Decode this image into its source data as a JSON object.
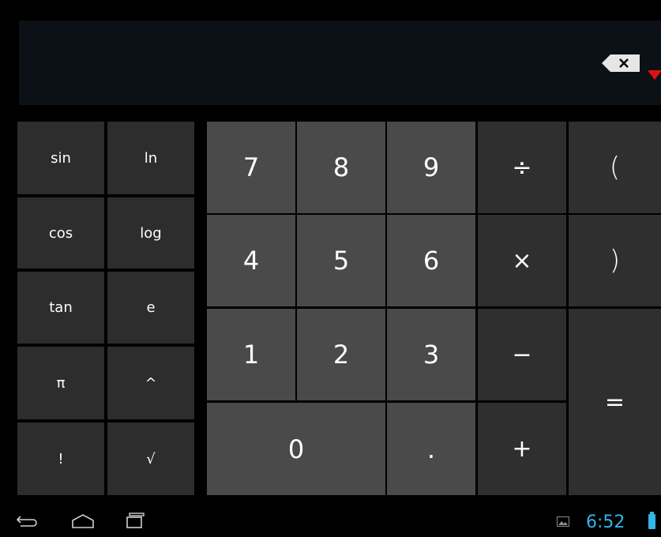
{
  "advanced_keys": [
    {
      "label": "sin"
    },
    {
      "label": "ln"
    },
    {
      "label": "cos"
    },
    {
      "label": "log"
    },
    {
      "label": "tan"
    },
    {
      "label": "e"
    },
    {
      "label": "π"
    },
    {
      "label": "^"
    },
    {
      "label": "!"
    },
    {
      "label": "√"
    }
  ],
  "digits": {
    "seven": "7",
    "eight": "8",
    "nine": "9",
    "four": "4",
    "five": "5",
    "six": "6",
    "one": "1",
    "two": "2",
    "three": "3",
    "zero": "0",
    "dot": "."
  },
  "operators": {
    "divide": "÷",
    "multiply": "×",
    "minus": "−",
    "plus": "+",
    "equals": "=",
    "open_paren": "(",
    "close_paren": ")"
  },
  "status": {
    "time": "6:52"
  },
  "colors": {
    "accent": "#33b5e5",
    "display_bg": "#0c1117",
    "caret": "#e01010"
  },
  "icons": [
    "backspace-icon",
    "back-icon",
    "home-icon",
    "recent-apps-icon",
    "gallery-icon",
    "battery-icon"
  ]
}
